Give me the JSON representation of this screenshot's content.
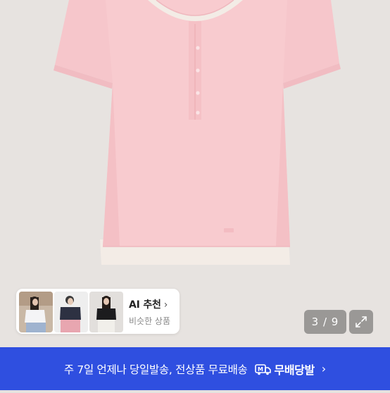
{
  "product_image": {
    "icon": "pink-henley-tshirt-photo"
  },
  "ai_recommend": {
    "title": "AI 추천",
    "chevron": "›",
    "subtitle": "비슷한 상품",
    "thumbnails": [
      "model-white-tee-photo",
      "model-navy-tee-photo",
      "model-black-tee-photo"
    ]
  },
  "gallery": {
    "counter": "3 / 9",
    "expand_icon": "expand-arrows-icon"
  },
  "banner": {
    "text": "주 7일 언제나 당일발송, 전상품 무료배송",
    "brand_label": "무배당발",
    "chevron": "›",
    "background_color": "#2f4fe0"
  }
}
